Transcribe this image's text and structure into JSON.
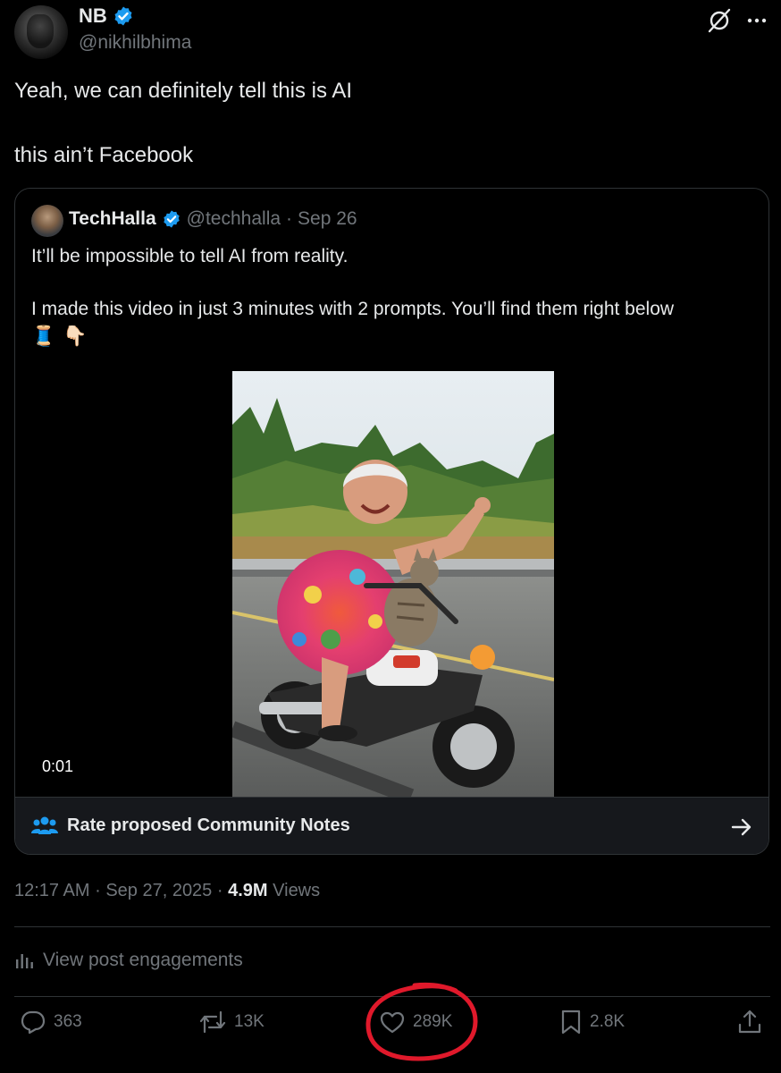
{
  "author": {
    "name": "NB",
    "handle": "@nikhilbhima",
    "verified": true
  },
  "post": {
    "line1": "Yeah, we can definitely tell this is AI",
    "line2": "this ain’t Facebook"
  },
  "quoted": {
    "name": "TechHalla",
    "handle": "@techhalla",
    "separator": "·",
    "date": "Sep 26",
    "line1": "It’ll be impossible to tell AI from reality.",
    "line2": "I made this video in just 3 minutes with 2 prompts. You’ll find them right below",
    "emoji": [
      "🧵",
      "👇🏻"
    ],
    "video_time": "0:01",
    "community_notes_label": "Rate proposed Community Notes"
  },
  "meta": {
    "time": "12:17 AM",
    "date": "Sep 27, 2025",
    "views_count": "4.9M",
    "views_label": "Views",
    "sep": "·"
  },
  "engagements_label": "View post engagements",
  "actions": {
    "replies": "363",
    "reposts": "13K",
    "likes": "289K",
    "bookmarks": "2.8K"
  },
  "colors": {
    "background": "#000000",
    "text": "#e7e9ea",
    "muted": "#71767b",
    "verified": "#1d9bf0",
    "annotation_circle": "#e0192b"
  },
  "icons": [
    "verified-badge-icon",
    "grok-icon",
    "more-icon",
    "community-notes-icon",
    "arrow-right-icon",
    "analytics-icon",
    "reply-icon",
    "repost-icon",
    "like-icon",
    "bookmark-icon",
    "share-icon"
  ]
}
